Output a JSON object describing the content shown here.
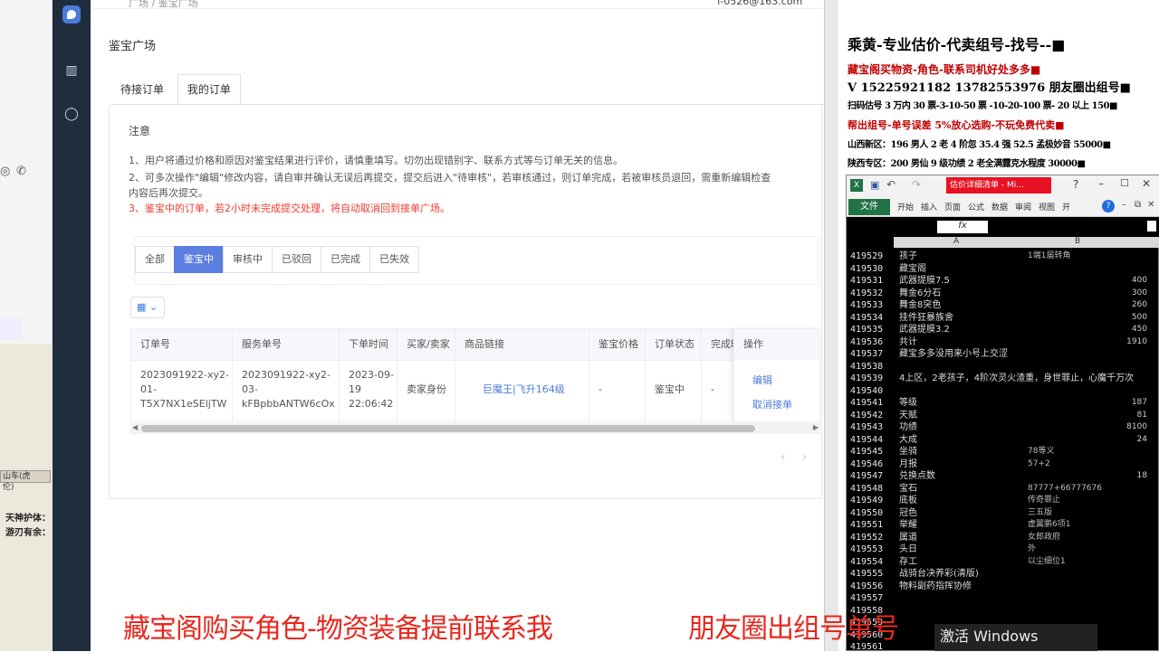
{
  "left_strip": {
    "tab_label": "山车(虎伦)",
    "line1": "天神护体：",
    "line2": "游刃有余："
  },
  "main": {
    "topbar_crumb": "广场 / 鉴宝广场",
    "topbar_email": "f-0526@163.com",
    "page_title": "鉴宝广场",
    "tabs": [
      {
        "label": "待接订单"
      },
      {
        "label": "我的订单"
      }
    ],
    "notice": {
      "title": "注意",
      "items": [
        "1、用户将通过价格和原因对鉴宝结果进行评价，请慎重填写。切勿出现错别字、联系方式等与订单无关的信息。",
        "2、可多次操作\"编辑\"修改内容，请自审并确认无误后再提交，提交后进入\"待审核\"，若审核通过，则订单完成，若被审核员退回，需重新编辑检查",
        "内容后再次提交。",
        "3、鉴宝中的订单，若2小时未完成提交处理，将自动取消回到接单广场。"
      ]
    },
    "status_filters": [
      {
        "label": "全部"
      },
      {
        "label": "鉴宝中"
      },
      {
        "label": "审核中"
      },
      {
        "label": "已驳回"
      },
      {
        "label": "已完成"
      },
      {
        "label": "已失效"
      }
    ],
    "table": {
      "headers": [
        "订单号",
        "服务单号",
        "下单时间",
        "买家/卖家",
        "商品链接",
        "鉴宝价格",
        "订单状态",
        "完成时间",
        "操作"
      ],
      "rows": [
        {
          "order_no": [
            "2023091922-xy2-",
            "01-",
            "T5X7NX1eSEljTW"
          ],
          "service_no": [
            "2023091922-xy2-",
            "03-",
            "kFBpbbANTW6cOx"
          ],
          "time": [
            "2023-09-",
            "19",
            "22:06:42"
          ],
          "role": "卖家身份",
          "product": "巨魔王|飞升164级",
          "price": "-",
          "status": "鉴宝中",
          "finish": "-",
          "ops": [
            "编辑",
            "取消接单"
          ]
        }
      ]
    }
  },
  "overlay": {
    "watermark_left": "藏宝阁购买角色-物资装备提前联系我",
    "watermark_right": "朋友圈出组号单号",
    "activate": "激活 Windows"
  },
  "right_panel": {
    "lines": [
      "乘黄-专业估价-代卖组号-找号--■",
      "藏宝阁买物资-角色-联系司机好处多多■",
      "V 15225921182    13782553976 朋友圈出组号■",
      "扫码估号 3 万内 30 票-3-10-50 票 -10-20-100 票- 20 以上 150■",
      "帮出组号-单号误差 5%放心选购-不玩免费代卖■",
      "山西新区：196 男人 2 老 4 阶忽 35.4 强 52.5 孟极妙音 55000■",
      "陕西专区：200 男仙 9 级功绩 2 老全满露克水程度 30000■"
    ]
  },
  "excel": {
    "doc_title": "估价详细清单 - Mi...",
    "file_label": "文件",
    "menus": [
      "开始",
      "插入",
      "页面",
      "公式",
      "数据",
      "审阅",
      "视图",
      "开"
    ],
    "fx": "fx",
    "col_a": "A",
    "col_b": "B",
    "rows": [
      {
        "n": "419529",
        "a": "孩子",
        "b": "1端1届转角",
        "c": ""
      },
      {
        "n": "419530",
        "a": "藏宝阁",
        "b": "",
        "c": ""
      },
      {
        "n": "419531",
        "a": "武器提膜7.5",
        "b": "",
        "c": "400"
      },
      {
        "n": "419532",
        "a": "舞金6分石",
        "b": "",
        "c": "300"
      },
      {
        "n": "419533",
        "a": "舞金8突色",
        "b": "",
        "c": "260"
      },
      {
        "n": "419534",
        "a": "挂件狂暴族舍",
        "b": "",
        "c": "500"
      },
      {
        "n": "419535",
        "a": "武器提膜3.2",
        "b": "",
        "c": "450"
      },
      {
        "n": "419536",
        "a": "共计",
        "b": "",
        "c": "1910"
      },
      {
        "n": "419537",
        "a": "藏宝多多没用来小号上交涩",
        "b": "",
        "c": ""
      },
      {
        "n": "419538",
        "a": "",
        "b": "",
        "c": ""
      },
      {
        "n": "419539",
        "a": "4上区，2老孩子，4阶次灵火渣重，身世罪止，心魔千万次",
        "b": "",
        "c": ""
      },
      {
        "n": "419540",
        "a": "",
        "b": "",
        "c": ""
      },
      {
        "n": "419541",
        "a": "等级",
        "b": "",
        "c": "187"
      },
      {
        "n": "419542",
        "a": "天赋",
        "b": "",
        "c": "81"
      },
      {
        "n": "419543",
        "a": "功绩",
        "b": "",
        "c": "8100"
      },
      {
        "n": "419544",
        "a": "大成",
        "b": "",
        "c": "24"
      },
      {
        "n": "419545",
        "a": "坐骑",
        "b": "78等义",
        "c": ""
      },
      {
        "n": "419546",
        "a": "月报",
        "b": "57+2",
        "c": ""
      },
      {
        "n": "419547",
        "a": "兑换点数",
        "b": "",
        "c": "18"
      },
      {
        "n": "419548",
        "a": "宝石",
        "b": "87777+66777676",
        "c": ""
      },
      {
        "n": "419549",
        "a": "底板",
        "b": "传奇罪止",
        "c": ""
      },
      {
        "n": "419550",
        "a": "冠色",
        "b": "三五版",
        "c": ""
      },
      {
        "n": "419551",
        "a": "举耀",
        "b": "虚翼鹏6项1",
        "c": ""
      },
      {
        "n": "419552",
        "a": "属道",
        "b": "女郎政府",
        "c": ""
      },
      {
        "n": "419553",
        "a": "头日",
        "b": "外",
        "c": ""
      },
      {
        "n": "419554",
        "a": "存工",
        "b": "以尘细位1",
        "c": ""
      },
      {
        "n": "419555",
        "a": "战骑台决养彩(清版)",
        "b": "",
        "c": ""
      },
      {
        "n": "419556",
        "a": "物料副药指挥协修",
        "b": "",
        "c": ""
      },
      {
        "n": "419557",
        "a": "",
        "b": "",
        "c": ""
      },
      {
        "n": "419558",
        "a": "",
        "b": "",
        "c": ""
      },
      {
        "n": "419559",
        "a": "",
        "b": "",
        "c": ""
      },
      {
        "n": "419560",
        "a": "",
        "b": "",
        "c": ""
      },
      {
        "n": "419561",
        "a": "",
        "b": "",
        "c": ""
      }
    ]
  }
}
